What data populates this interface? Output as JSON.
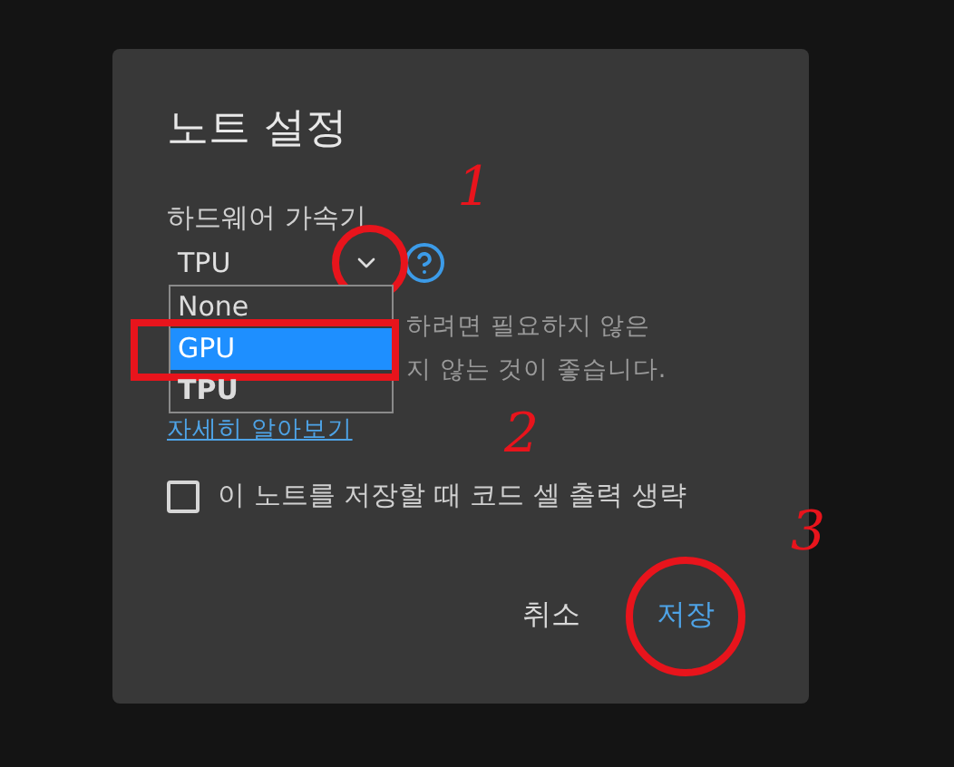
{
  "dialog": {
    "title": "노트 설정",
    "accelerator": {
      "label": "하드웨어 가속기",
      "value": "TPU",
      "expanded": true,
      "chevron_highlighted": true,
      "options": [
        {
          "label": "None",
          "selected": false,
          "hovered": false,
          "highlighted": false
        },
        {
          "label": "GPU",
          "selected": false,
          "hovered": true,
          "highlighted": true
        },
        {
          "label": "TPU",
          "selected": true,
          "hovered": false,
          "highlighted": false
        }
      ]
    },
    "help_lines": [
      "하려면 필요하지 않은",
      "지 않는 것이 좋습니다."
    ],
    "learn_more_link": "자세히 알아보기",
    "omit_output": {
      "label": "이 노트를 저장할 때 코드 셀 출력 생략",
      "checked": false
    },
    "buttons": [
      {
        "label": "취소",
        "kind": "secondary",
        "highlighted": false
      },
      {
        "label": "저장",
        "kind": "primary",
        "highlighted": true
      }
    ]
  },
  "annotation_marks": [
    "1",
    "2",
    "3"
  ]
}
